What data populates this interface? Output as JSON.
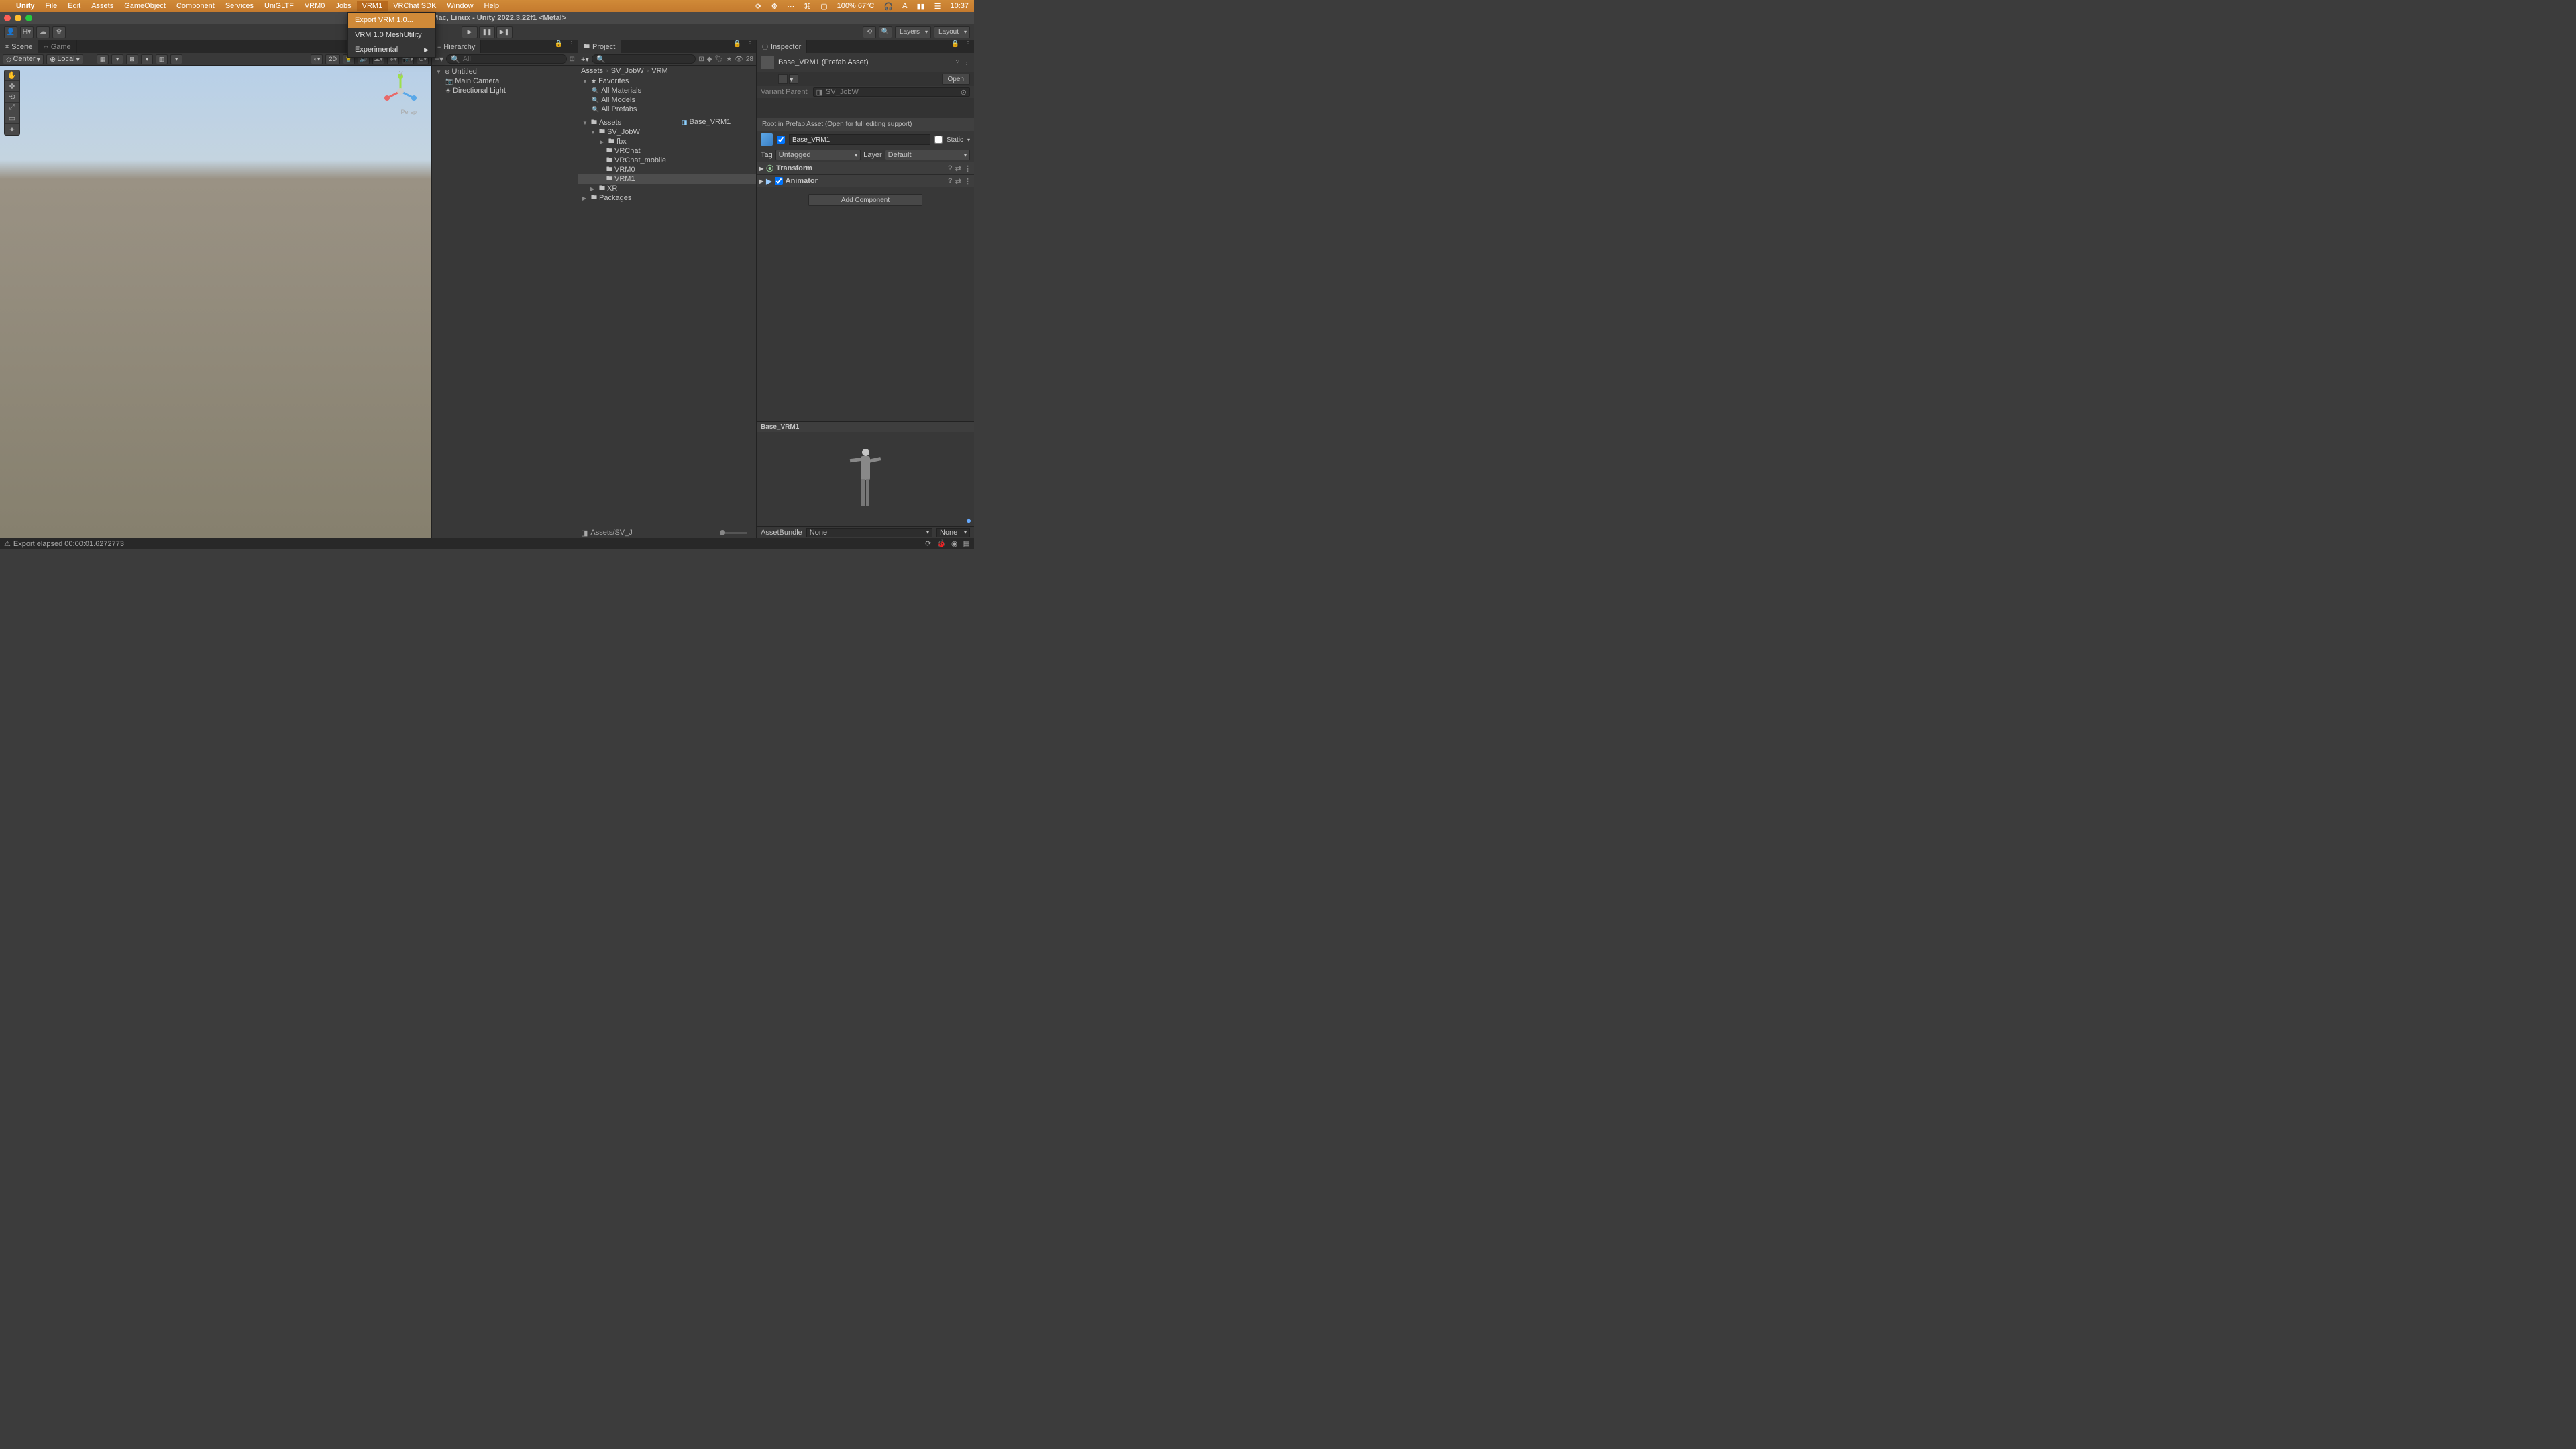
{
  "mac_menu": {
    "app": "Unity",
    "items": [
      "File",
      "Edit",
      "Assets",
      "GameObject",
      "Component",
      "Services",
      "UniGLTF",
      "VRM0",
      "Jobs",
      "VRM1",
      "VRChat SDK",
      "Window",
      "Help"
    ],
    "active_index": 9,
    "right": {
      "temp": "100% 67°C",
      "time": "10:37"
    }
  },
  "dropdown": {
    "items": [
      {
        "label": "Export VRM 1.0...",
        "highlighted": true,
        "submenu": false
      },
      {
        "label": "VRM 1.0 MeshUtility",
        "highlighted": false,
        "submenu": false
      },
      {
        "label": "Experimental",
        "highlighted": false,
        "submenu": true
      }
    ]
  },
  "window_title": "y - Windows, Mac, Linux - Unity 2022.3.22f1 <Metal>",
  "toolbar": {
    "layers": "Layers",
    "layout": "Layout"
  },
  "scene": {
    "tabs": [
      {
        "label": "Scene",
        "icon": "⌗",
        "active": true
      },
      {
        "label": "Game",
        "icon": "🎮",
        "active": false
      }
    ],
    "pivot": "Center",
    "space": "Local",
    "mode2d": "2D",
    "gizmo_label": "Persp"
  },
  "hierarchy": {
    "title": "Hierarchy",
    "search_placeholder": "All",
    "root": "Untitled",
    "children": [
      "Main Camera",
      "Directional Light"
    ]
  },
  "project": {
    "title": "Project",
    "badge": "28",
    "crumbs": [
      "Assets",
      "SV_JobW",
      "VRM"
    ],
    "favorites": {
      "label": "Favorites",
      "items": [
        "All Materials",
        "All Models",
        "All Prefabs"
      ]
    },
    "assets": {
      "label": "Assets",
      "sv": "SV_JobW",
      "children": [
        "fbx",
        "VRChat",
        "VRChat_mobile",
        "VRM0",
        "VRM1"
      ],
      "xr": "XR"
    },
    "packages": "Packages",
    "selected": "Base_VRM1",
    "footer_path": "Assets/SV_J"
  },
  "inspector": {
    "title": "Inspector",
    "asset_name": "Base_VRM1 (Prefab Asset)",
    "open": "Open",
    "variant_parent_label": "Variant Parent",
    "variant_parent_value": "SV_JobW",
    "root_msg": "Root in Prefab Asset (Open for full editing support)",
    "go_name": "Base_VRM1",
    "static": "Static",
    "tag_label": "Tag",
    "tag_value": "Untagged",
    "layer_label": "Layer",
    "layer_value": "Default",
    "components": [
      {
        "name": "Transform",
        "checkbox": false
      },
      {
        "name": "Animator",
        "checkbox": true
      }
    ],
    "add_component": "Add Component",
    "preview_title": "Base_VRM1",
    "assetbundle_label": "AssetBundle",
    "assetbundle_value": "None",
    "assetbundle_variant": "None"
  },
  "status": {
    "msg": "Export elapsed 00:00:01.6272773"
  }
}
